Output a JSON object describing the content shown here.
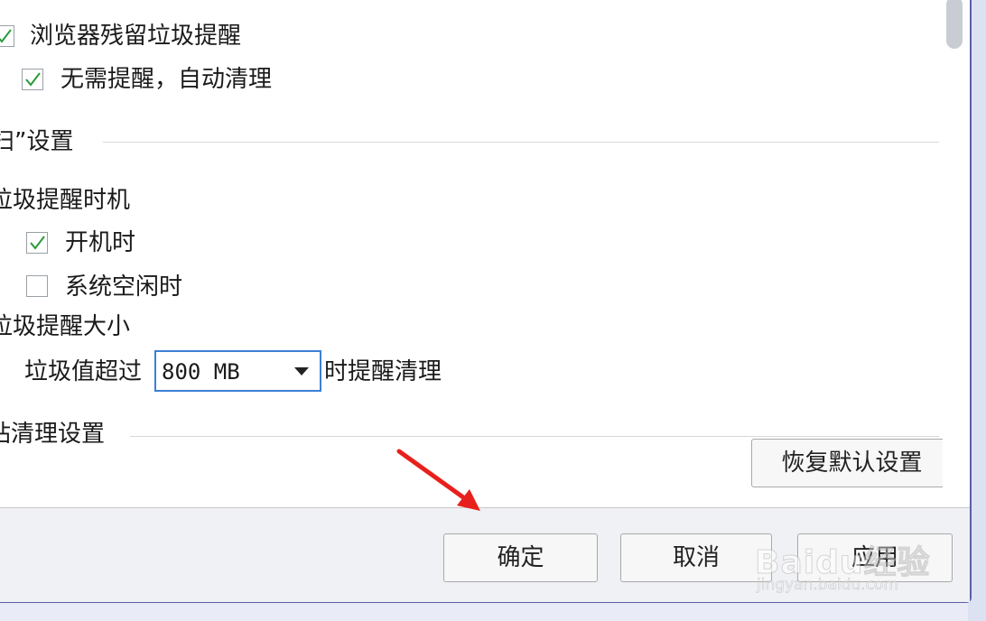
{
  "options": {
    "browser_junk_reminder": {
      "label": "浏览器残留垃圾提醒",
      "checked": true
    },
    "auto_clean": {
      "label": "无需提醒，自动清理",
      "checked": true
    }
  },
  "scan_section": {
    "title": "扫”设置"
  },
  "reminder_timing": {
    "title": "垃圾提醒时机",
    "on_boot": {
      "label": "开机时",
      "checked": true
    },
    "on_idle": {
      "label": "系统空闲时",
      "checked": false
    }
  },
  "reminder_size": {
    "title": "垃圾提醒大小",
    "prefix": "垃圾值超过",
    "selected": "800 MB",
    "suffix": "时提醒清理"
  },
  "site_clean_section": {
    "title": "站清理设置"
  },
  "buttons": {
    "restore_defaults": "恢复默认设置",
    "ok": "确定",
    "cancel": "取消",
    "apply": "应用"
  },
  "watermark": {
    "brand": "Baidu经验",
    "url": "jingyan.baidu.com"
  },
  "colors": {
    "check": "#2a9a3a",
    "arrow": "#e8201c",
    "select_border": "#3c7fd6"
  }
}
